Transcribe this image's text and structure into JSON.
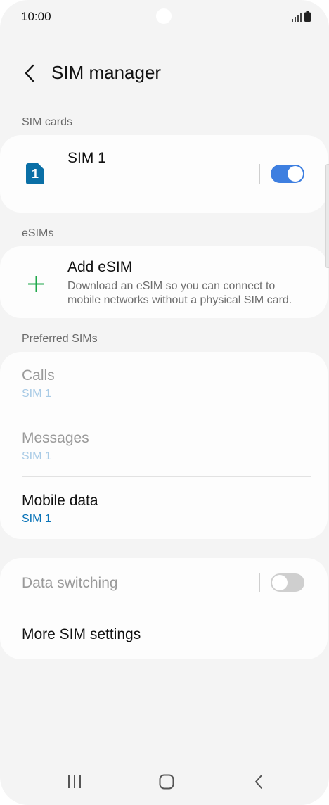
{
  "status_bar": {
    "time": "10:00"
  },
  "header": {
    "title": "SIM manager"
  },
  "sections": {
    "sim_cards": "SIM cards",
    "esims": "eSIMs",
    "preferred": "Preferred SIMs"
  },
  "sim1": {
    "badge": "1",
    "label": "SIM 1",
    "enabled": true
  },
  "add_esim": {
    "title": "Add eSIM",
    "description_line1": "Download an eSIM so you can connect to",
    "description_line2": "mobile networks without a physical SIM card."
  },
  "preferred": {
    "calls": {
      "title": "Calls",
      "value": "SIM 1",
      "enabled": false
    },
    "messages": {
      "title": "Messages",
      "value": "SIM 1",
      "enabled": false
    },
    "mobile_data": {
      "title": "Mobile data",
      "value": "SIM 1",
      "enabled": true
    }
  },
  "other": {
    "data_switching": {
      "title": "Data switching",
      "enabled": false,
      "toggle_on": false
    },
    "more_settings": "More SIM settings"
  },
  "colors": {
    "accent": "#3e7fe0",
    "sim_badge": "#0a6fa6",
    "value_active": "#0a74b8",
    "value_disabled": "#a9cbe6",
    "disabled_text": "#9a9a9a",
    "plus_icon": "#1fa84a"
  }
}
